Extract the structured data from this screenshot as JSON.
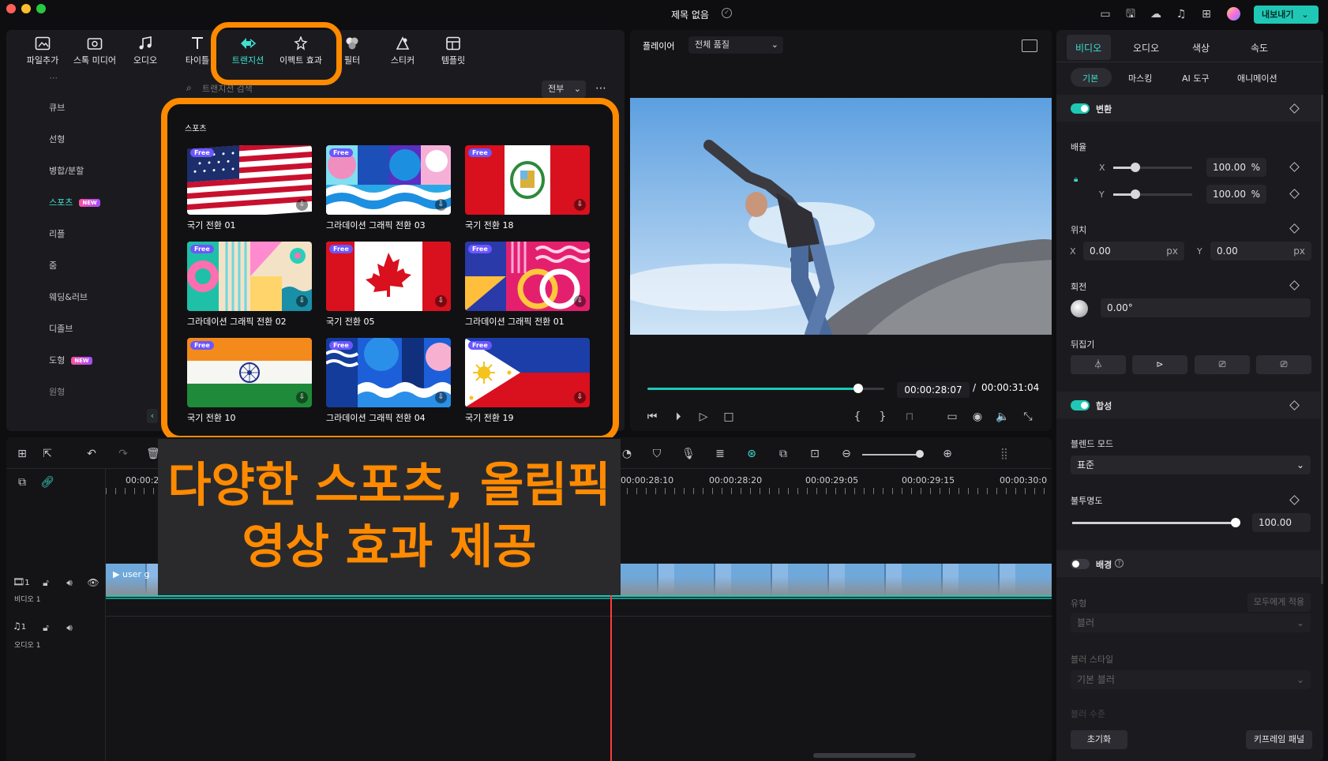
{
  "window": {
    "title": "제목 없음",
    "export_label": "내보내기"
  },
  "toolbar": {
    "items": [
      {
        "label": "파일추가",
        "icon": "import-icon"
      },
      {
        "label": "스톡 미디어",
        "icon": "stock-media-icon"
      },
      {
        "label": "오디오",
        "icon": "music-note-icon"
      },
      {
        "label": "타이틀",
        "icon": "title-t-icon"
      },
      {
        "label": "트랜지션",
        "icon": "transition-icon"
      },
      {
        "label": "이펙트 효과",
        "icon": "effects-sparkle-icon"
      },
      {
        "label": "필터",
        "icon": "filter-icon"
      },
      {
        "label": "스티커",
        "icon": "sticker-icon"
      },
      {
        "label": "템플릿",
        "icon": "template-icon"
      }
    ]
  },
  "sidebar": {
    "items": [
      {
        "label": "큐브",
        "badge": ""
      },
      {
        "label": "선형",
        "badge": ""
      },
      {
        "label": "병합/분할",
        "badge": ""
      },
      {
        "label": "스포츠",
        "badge": "NEW"
      },
      {
        "label": "리플",
        "badge": ""
      },
      {
        "label": "줌",
        "badge": ""
      },
      {
        "label": "웨딩&러브",
        "badge": ""
      },
      {
        "label": "디졸브",
        "badge": ""
      },
      {
        "label": "도형",
        "badge": "NEW"
      },
      {
        "label": "원형",
        "badge": ""
      }
    ]
  },
  "search": {
    "placeholder": "트랜지션 검색",
    "filter": "전부"
  },
  "grid": {
    "section": "스포츠",
    "free_label": "Free",
    "items": [
      {
        "label": "국기 전환 01",
        "thumb": "usa-flag"
      },
      {
        "label": "그라데이션 그래픽 전환 03",
        "thumb": "graphic-waves"
      },
      {
        "label": "국기 전환 18",
        "thumb": "peru-flag"
      },
      {
        "label": "그라데이션 그래픽 전환 02",
        "thumb": "graphic-geo"
      },
      {
        "label": "국기 전환 05",
        "thumb": "canada-flag"
      },
      {
        "label": "그라데이션 그래픽 전환 01",
        "thumb": "graphic-rings"
      },
      {
        "label": "국기 전환 10",
        "thumb": "india-flag"
      },
      {
        "label": "그라데이션 그래픽 전환 04",
        "thumb": "graphic-blue"
      },
      {
        "label": "국기 전환 19",
        "thumb": "philippines-flag"
      }
    ]
  },
  "overlay": {
    "line1": "다양한 스포츠, 올림픽",
    "line2": "영상 효과 제공"
  },
  "player": {
    "label": "플레이어",
    "quality": "전체 품질",
    "current": "00:00:28:07",
    "separator": "/",
    "total": "00:00:31:04",
    "progress": 0.89
  },
  "right": {
    "tabs": [
      "비디오",
      "오디오",
      "색상",
      "속도"
    ],
    "subtabs": [
      "기본",
      "마스킹",
      "AI 도구",
      "애니메이션"
    ],
    "transform": "변환",
    "scale": "배율",
    "x_label": "X",
    "y_label": "Y",
    "scale_x": "100.00",
    "scale_y": "100.00",
    "pct": "%",
    "position": "위치",
    "pos_x": "0.00",
    "pos_y": "0.00",
    "px": "px",
    "rotation": "회전",
    "rotation_value": "0.00°",
    "flip": "뒤집기",
    "composite": "합성",
    "blend_mode": "블렌드 모드",
    "blend_value": "표준",
    "opacity": "불투명도",
    "opacity_value": "100.00",
    "background": "배경",
    "type": "유형",
    "apply_all": "모두에게 적용",
    "type_value": "블러",
    "blur_style": "블러 스타일",
    "blur_style_value": "기본 블러",
    "blur_level": "블러 수준",
    "reset": "초기화",
    "keyframe": "키프레임 패널"
  },
  "timeline": {
    "times": [
      "00:00:2",
      "00:00:28:10",
      "00:00:28:20",
      "00:00:29:05",
      "00:00:29:15",
      "00:00:30:0"
    ],
    "video_track": "비디오 1",
    "video_num": "1",
    "audio_track": "오디오 1",
    "audio_num": "1",
    "clip_label": "user g"
  },
  "colors": {
    "accent": "#1fc8b5",
    "highlight": "#ff8a00",
    "playhead": "#ff3b3b"
  }
}
